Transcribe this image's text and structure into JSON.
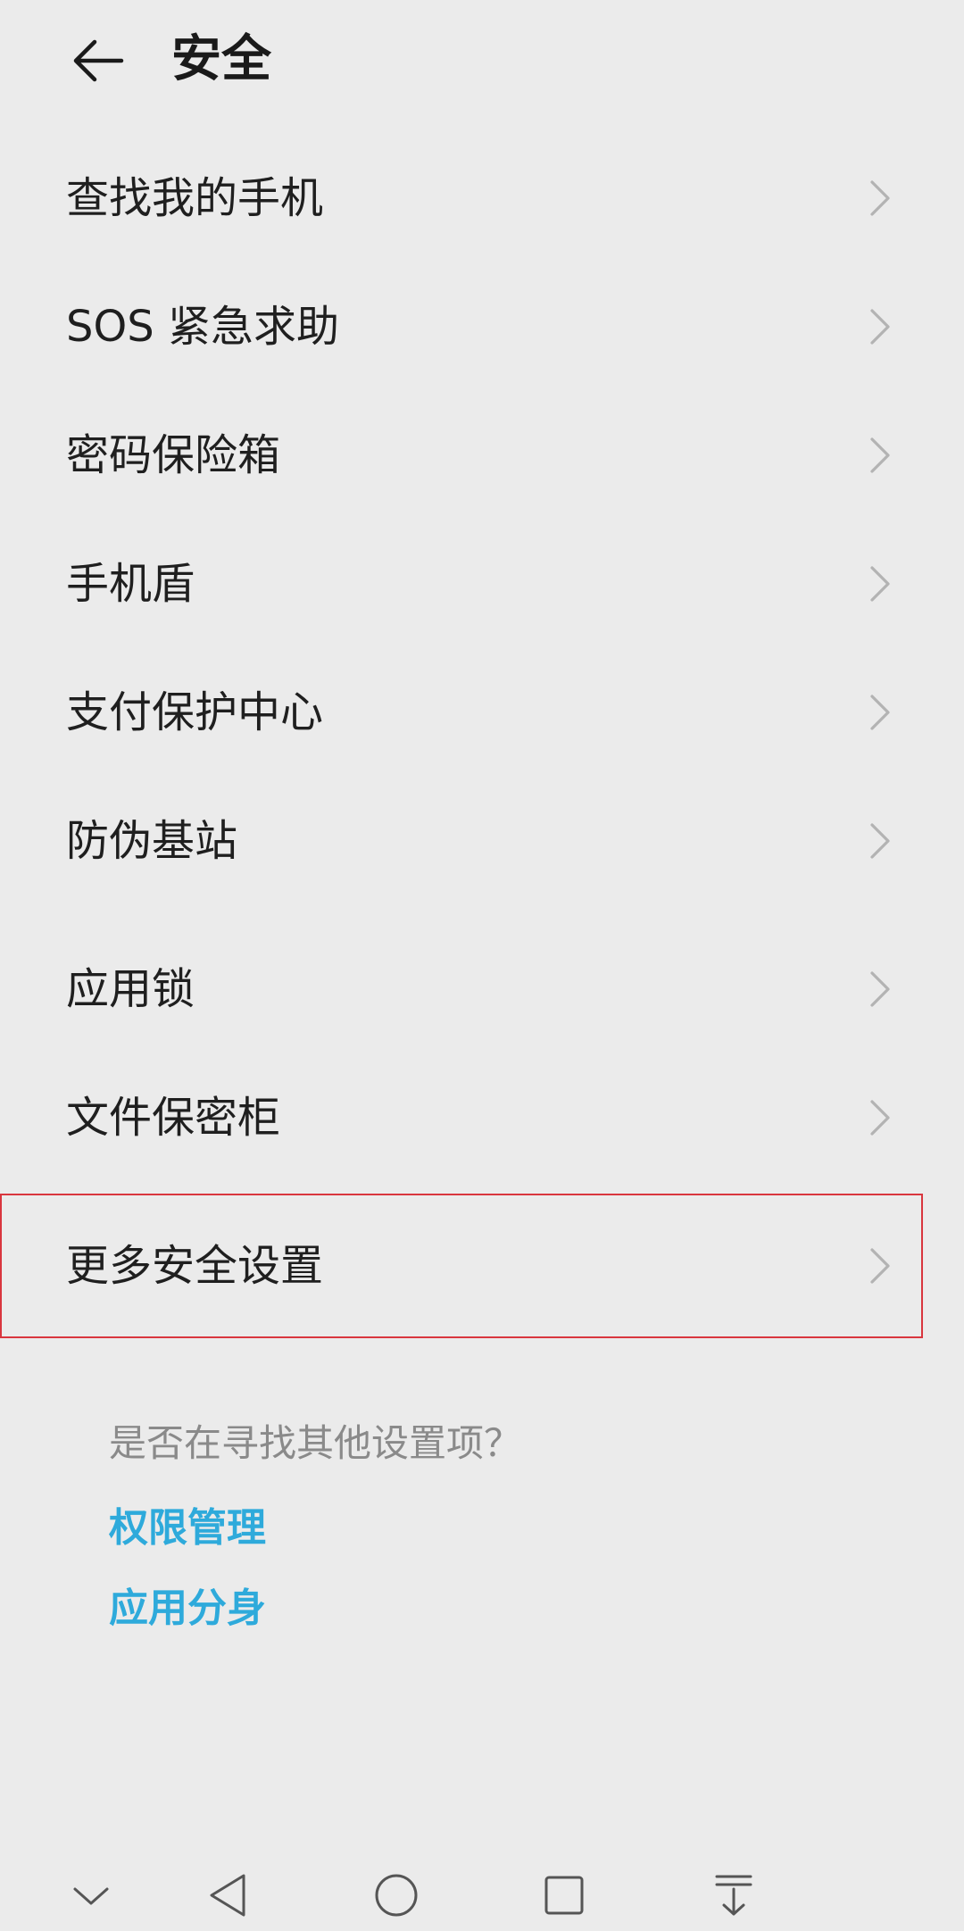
{
  "header": {
    "title": "安全",
    "back_icon": "arrow-left-icon"
  },
  "menu": [
    {
      "label": "查找我的手机"
    },
    {
      "label": "SOS 紧急求助"
    },
    {
      "label": "密码保险箱"
    },
    {
      "label": "手机盾"
    },
    {
      "label": "支付保护中心"
    },
    {
      "label": "防伪基站"
    },
    {
      "label": "应用锁"
    },
    {
      "label": "文件保密柜"
    },
    {
      "label": "更多安全设置",
      "highlighted": true
    }
  ],
  "suggestions": {
    "prompt": "是否在寻找其他设置项？",
    "links": [
      "权限管理",
      "应用分身"
    ]
  },
  "navbar": {
    "icons": [
      "chevron-down-icon",
      "back-triangle-icon",
      "home-circle-icon",
      "recents-square-icon",
      "notification-pulldown-icon"
    ]
  },
  "colors": {
    "background": "#ebebeb",
    "link": "#2eaadb",
    "highlight_border": "#d9363e",
    "text": "#1f1f1f",
    "secondary_text": "#8a8a8a"
  }
}
